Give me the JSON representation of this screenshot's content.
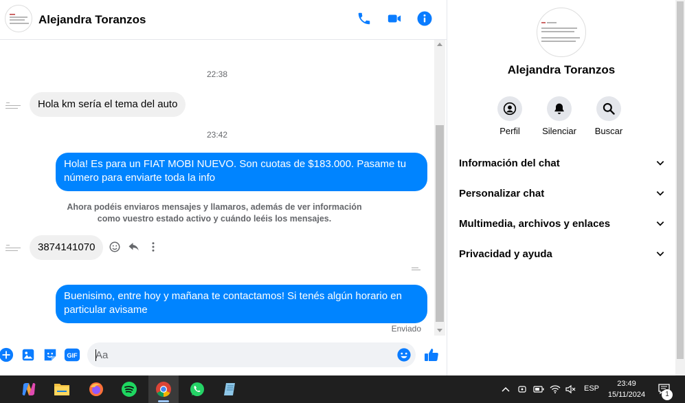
{
  "header": {
    "contact_name": "Alejandra Toranzos",
    "actions": [
      "phone-icon",
      "video-icon",
      "info-icon"
    ]
  },
  "messages": [
    {
      "type": "timestamp",
      "text": "22:38"
    },
    {
      "type": "incoming",
      "text": "Hola km sería el tema del auto"
    },
    {
      "type": "timestamp",
      "text": "23:42"
    },
    {
      "type": "outgoing",
      "text": "Hola! Es para un FIAT MOBI NUEVO. Son cuotas de $183.000. Pasame tu número para enviarte toda la info"
    },
    {
      "type": "notice",
      "text": "Ahora podéis enviaros mensajes y llamaros, además de ver información como vuestro estado activo y cuándo leéis los mensajes."
    },
    {
      "type": "incoming",
      "text": "3874141070"
    },
    {
      "type": "outgoing",
      "text": "Buenisimo, entre hoy y mañana te contactamos! Si tenés algún horario en particular avisame"
    }
  ],
  "status": {
    "sent": "Enviado"
  },
  "composer": {
    "placeholder": "Aa",
    "gif_label": "GIF"
  },
  "info_panel": {
    "name": "Alejandra Toranzos",
    "actions": [
      {
        "label": "Perfil",
        "icon": "profile-icon"
      },
      {
        "label": "Silenciar",
        "icon": "bell-icon"
      },
      {
        "label": "Buscar",
        "icon": "search-icon"
      }
    ],
    "sections": [
      "Información del chat",
      "Personalizar chat",
      "Multimedia, archivos y enlaces",
      "Privacidad y ayuda"
    ]
  },
  "taskbar": {
    "apps": [
      "copilot-icon",
      "file-explorer-icon",
      "firefox-icon",
      "spotify-icon",
      "chrome-icon",
      "whatsapp-icon",
      "notes-icon"
    ],
    "language": "ESP",
    "time": "23:49",
    "date": "15/11/2024",
    "notification_count": "1"
  },
  "colors": {
    "accent": "#0084ff",
    "incoming_bubble": "#f0f0f0",
    "taskbar": "#1f1f1f"
  }
}
